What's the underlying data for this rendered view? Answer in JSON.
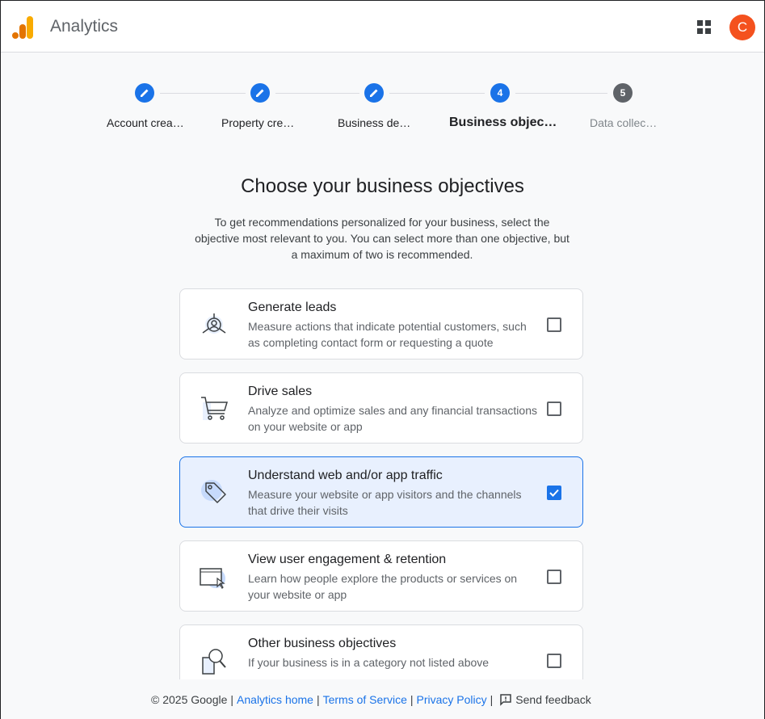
{
  "header": {
    "app_title": "Analytics",
    "avatar_letter": "C",
    "logo_icon": "analytics-logo-icon",
    "apps_icon": "apps-grid-icon"
  },
  "stepper": {
    "steps": [
      {
        "label": "Account crea…",
        "number": "",
        "state": "completed"
      },
      {
        "label": "Property cre…",
        "number": "",
        "state": "completed"
      },
      {
        "label": "Business de…",
        "number": "",
        "state": "completed"
      },
      {
        "label": "Business objec…",
        "number": "4",
        "state": "active"
      },
      {
        "label": "Data collec…",
        "number": "5",
        "state": "pending"
      }
    ]
  },
  "main": {
    "heading": "Choose your business objectives",
    "description": "To get recommendations personalized for your business, select the objective most relevant to you. You can select more than one objective, but a maximum of two is recommended."
  },
  "objectives": [
    {
      "title": "Generate leads",
      "description": "Measure actions that indicate potential customers, such as completing contact form or requesting a quote",
      "checked": false,
      "icon": "leads-icon"
    },
    {
      "title": "Drive sales",
      "description": "Analyze and optimize sales and any financial transactions on your website or app",
      "checked": false,
      "icon": "shopping-cart-icon"
    },
    {
      "title": "Understand web and/or app traffic",
      "description": "Measure your website or app visitors and the channels that drive their visits",
      "checked": true,
      "icon": "tag-icon"
    },
    {
      "title": "View user engagement & retention",
      "description": "Learn how people explore the products or services on your website or app",
      "checked": false,
      "icon": "browser-cursor-icon"
    },
    {
      "title": "Other business objectives",
      "description": "If your business is in a category not listed above",
      "checked": false,
      "icon": "magnifier-icon"
    }
  ],
  "footer": {
    "copyright": "© 2025 Google",
    "analytics_home": "Analytics home",
    "terms": "Terms of Service",
    "privacy": "Privacy Policy",
    "feedback": "Send feedback"
  },
  "colors": {
    "accent": "#1a73e8",
    "avatar": "#f4511e",
    "logo_orange": "#f9ab00",
    "logo_dark_orange": "#e37400"
  }
}
